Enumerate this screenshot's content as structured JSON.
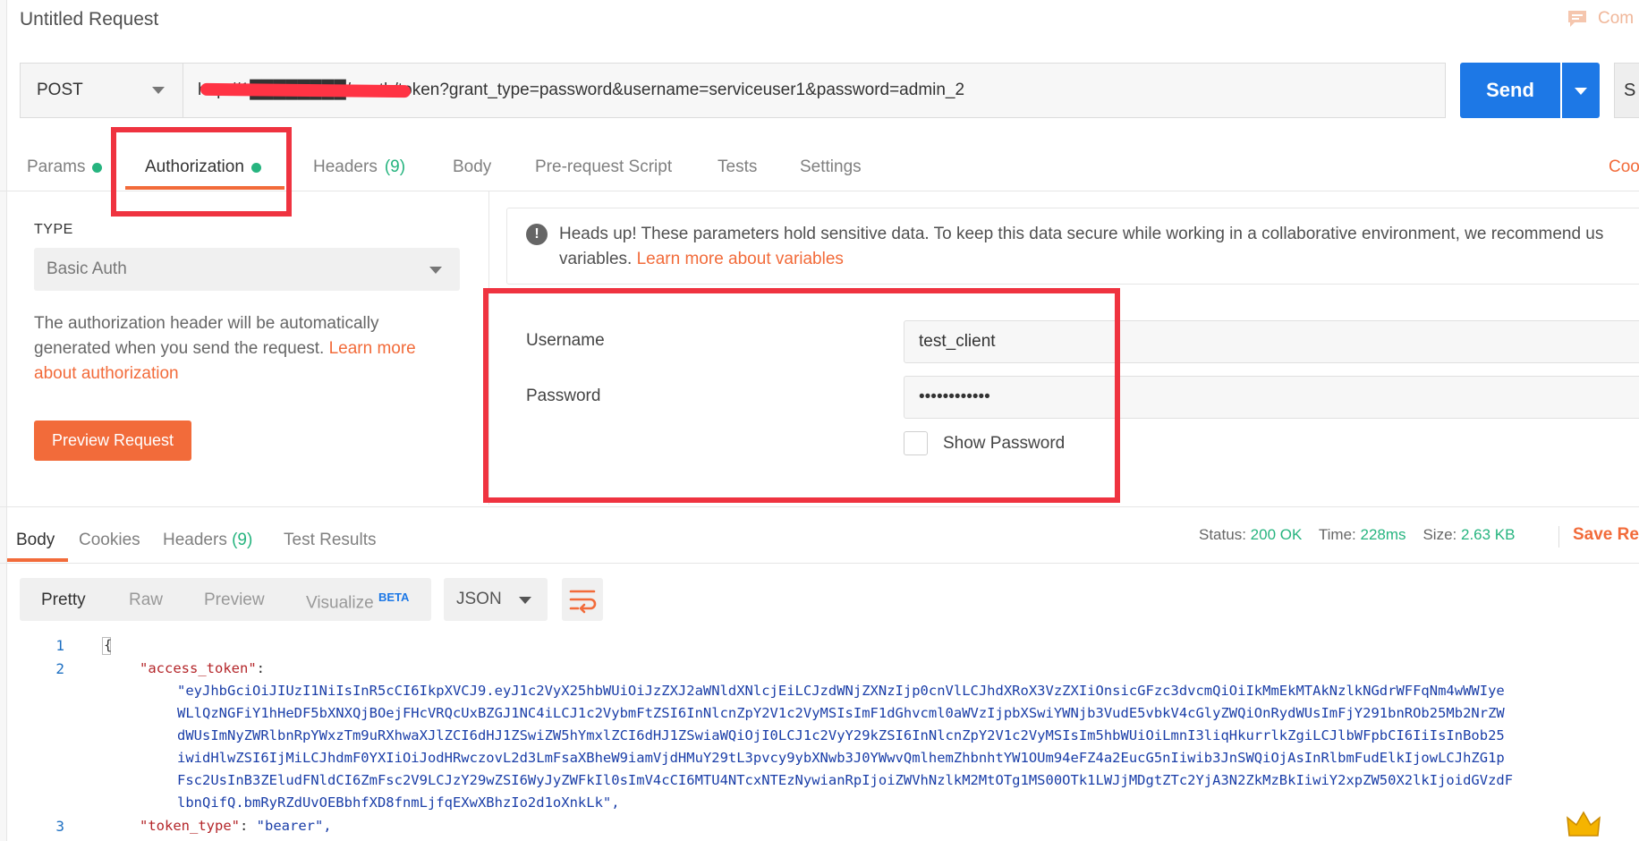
{
  "request": {
    "title": "Untitled Request",
    "comments_label": "Com",
    "method": "POST",
    "url": "http://1████████/oauth/token?grant_type=password&username=serviceuser1&password=admin_2",
    "send_label": "Send",
    "save_label": "S"
  },
  "request_tabs": [
    {
      "label": "Params",
      "dot": true
    },
    {
      "label": "Authorization",
      "dot": true,
      "active": true
    },
    {
      "label": "Headers",
      "count": "(9)"
    },
    {
      "label": "Body"
    },
    {
      "label": "Pre-request Script"
    },
    {
      "label": "Tests"
    },
    {
      "label": "Settings"
    }
  ],
  "cookies_link": "Coo",
  "auth": {
    "type_label": "TYPE",
    "type_value": "Basic Auth",
    "description": "The authorization header will be automatically generated when you send the request.",
    "learn_more": "Learn more about authorization",
    "preview_button": "Preview Request"
  },
  "notice": {
    "line1": "Heads up! These parameters hold sensitive data. To keep this data secure while working in a collaborative environment, we recommend us",
    "line2_prefix": "variables.",
    "line2_link": "Learn more about variables"
  },
  "credentials": {
    "username_label": "Username",
    "username_value": "test_client",
    "password_label": "Password",
    "password_value": "••••••••••••",
    "show_password_label": "Show Password"
  },
  "response_tabs": [
    {
      "label": "Body",
      "active": true
    },
    {
      "label": "Cookies"
    },
    {
      "label": "Headers",
      "count": "(9)"
    },
    {
      "label": "Test Results"
    }
  ],
  "status": {
    "status_label": "Status:",
    "status_value": "200 OK",
    "time_label": "Time:",
    "time_value": "228ms",
    "size_label": "Size:",
    "size_value": "2.63 KB",
    "save_response": "Save Res"
  },
  "format_tabs": [
    {
      "label": "Pretty",
      "active": true
    },
    {
      "label": "Raw"
    },
    {
      "label": "Preview"
    },
    {
      "label": "Visualize",
      "badge": "BETA"
    }
  ],
  "format_select": "JSON",
  "code": {
    "line_numbers": [
      "1",
      "2",
      "3"
    ],
    "open_brace": "{",
    "access_token_key": "\"access_token\"",
    "access_token_lines": [
      "\"eyJhbGciOiJIUzI1NiIsInR5cCI6IkpXVCJ9.eyJ1c2VyX25hbWUiOiJzZXJ2aWNldXNlcjEiLCJzdWNjZXNzIjp0cnVlLCJhdXRoX3VzZXIiOnsicGFzc3dvcmQiOiIkMmEkMTAkNzlkNGdrWFFqNm4wWWIye",
      "WLlQzNGFiY1hHeDF5bXNXQjBOejFHcVRQcUxBZGJ1NC4iLCJ1c2VybmFtZSI6InNlcnZpY2V1c2VyMSIsImF1dGhvcml0aWVzIjpbXSwiYWNjb3VudE5vbkV4cGlyZWQiOnRydWUsImFjY291bnROb25Mb2NrZW",
      "dWUsImNyZWRlbnRpYWxzTm9uRXhwaXJlZCI6dHJ1ZSwiZW5hYmxlZCI6dHJ1ZSwiaWQiOjI0LCJ1c2VyY29kZSI6InNlcnZpY2V1c2VyMSIsIm5hbWUiOiLmnI3liqHkurrlkZgiLCJlbWFpbCI6IiIsInBob25",
      "iwidHlwZSI6IjMiLCJhdmF0YXIiOiJodHRwczovL2d3LmFsaXBheW9iamVjdHMuY29tL3pvcy9ybXNwb3J0YWwvQmlhemZhbnhtYW1OUm94eFZ4a2EucG5nIiwib3JnSWQiOjAsInRlbmFudElkIjowLCJhZG1p",
      "Fsc2UsInB3ZEludFNldCI6ZmFsc2V9LCJzY29wZSI6WyJyZWFkIl0sImV4cCI6MTU4NTcxNTEzNywianRpIjoiZWVhNzlkM2MtOTg1MS00OTk1LWJjMDgtZTc2YjA3N2ZkMzBkIiwiY2xpZW50X2lkIjoidGVzdF",
      "lbnQifQ.bmRyRZdUvOEBbhfXD8fnmLjfqEXwXBhzIo2d1oXnkLk\","
    ],
    "token_type_key": "\"token_type\"",
    "token_type_value": "\"bearer\","
  }
}
